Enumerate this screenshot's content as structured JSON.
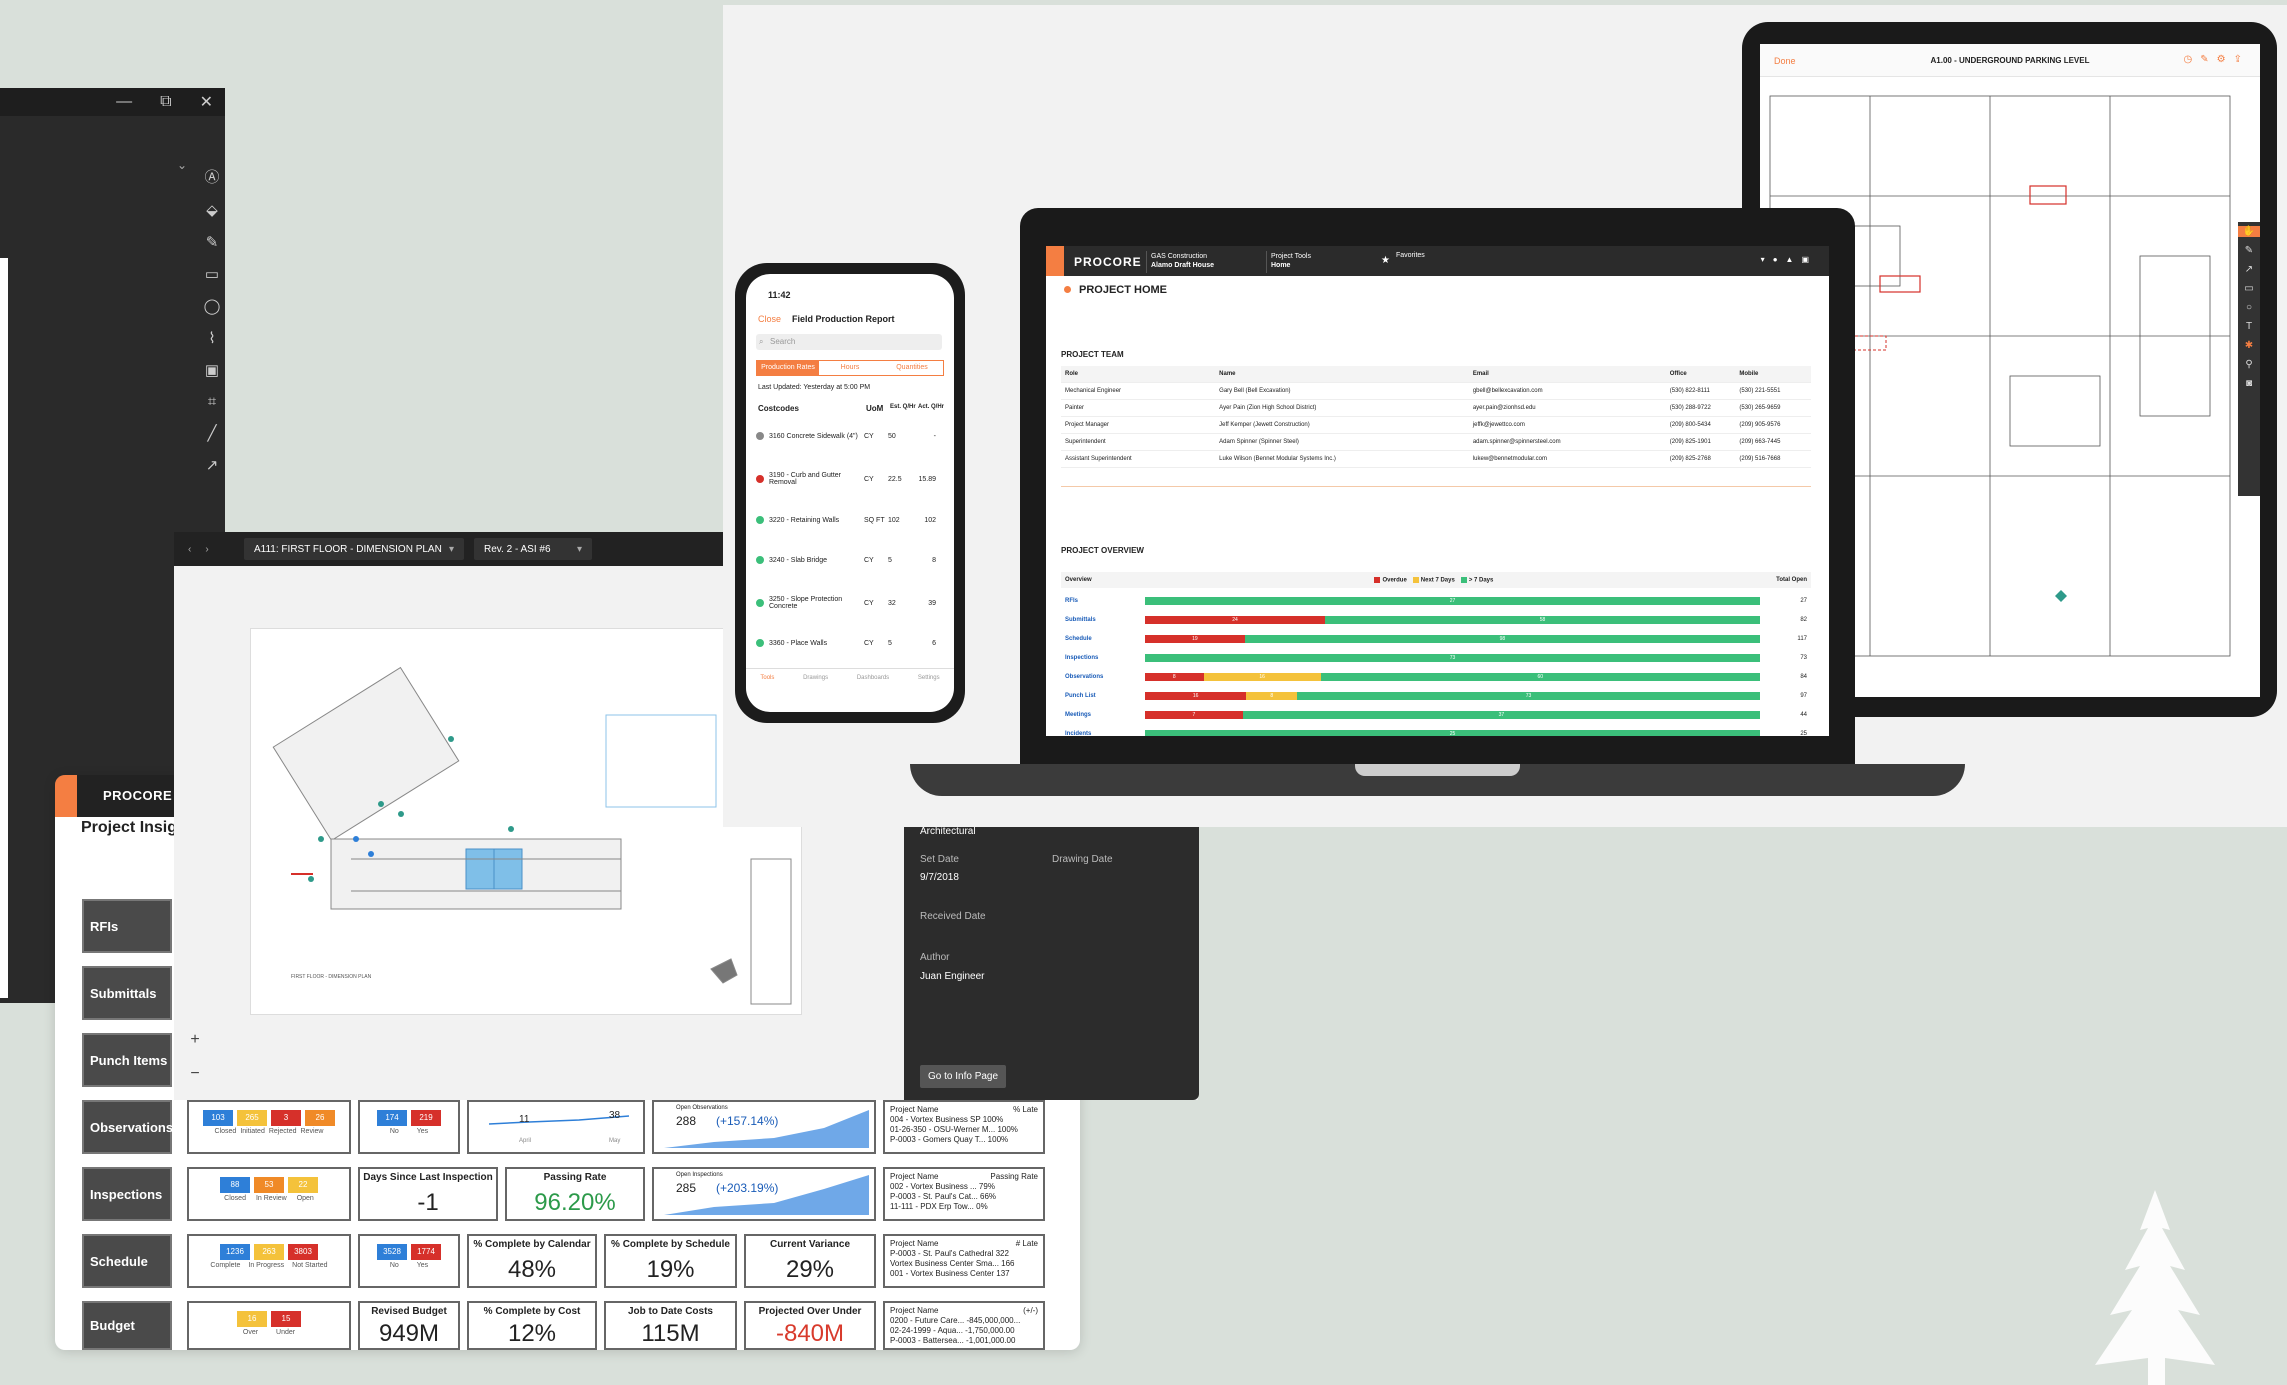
{
  "desktop_window": {
    "titlebar_controls": [
      "—",
      "⧉",
      "✕"
    ],
    "tool_icons": [
      "text-tool-icon",
      "fill-icon",
      "pen-icon",
      "text-box-icon",
      "lasso-icon",
      "callout-icon",
      "image-icon",
      "crop-icon",
      "line-icon",
      "arrow-icon",
      "arc-icon"
    ]
  },
  "insights": {
    "brand": "PROCORE",
    "title": "Project Insigl",
    "rows": [
      {
        "label": "RFIs"
      },
      {
        "label": "Submittals"
      },
      {
        "label": "Punch Items"
      },
      {
        "label": "Observations"
      },
      {
        "label": "Inspections"
      },
      {
        "label": "Schedule"
      },
      {
        "label": "Budget"
      }
    ],
    "observations": {
      "chips": [
        "103",
        "265",
        "3",
        "26"
      ],
      "chip_labels": [
        "Closed",
        "Initiated",
        "Rejected",
        "Review"
      ],
      "nos": [
        "174",
        "219"
      ],
      "no_yes": [
        "No",
        "Yes"
      ],
      "trend_low": "11",
      "trend_high": "38",
      "trend_months": [
        "April",
        "May"
      ],
      "open_label": "Open Observations",
      "open_value": "288",
      "open_delta": "(+157.14%)",
      "table_head": [
        "Project Name",
        "% Late"
      ],
      "table_rows": [
        "004 - Vortex Business SP   100%",
        "01-26-350 - OSU-Werner M...   100%",
        "P-0003 - Gomers Quay T...   100%"
      ]
    },
    "inspections": {
      "chips": [
        "88",
        "53",
        "22"
      ],
      "chip_labels": [
        "Closed",
        "In Review",
        "Open"
      ],
      "days_label": "Days Since Last Inspection",
      "days_value": "-1",
      "passing_label": "Passing Rate",
      "passing_value": "96.20%",
      "open_label": "Open Inspections",
      "open_value": "285",
      "open_delta": "(+203.19%)",
      "table_head": [
        "Project Name",
        "Passing Rate"
      ],
      "table_rows": [
        "002 - Vortex Business ...   79%",
        "P-0003 - St. Paul's Cat...   66%",
        "11-111 - PDX Erp Tow...   0%"
      ]
    },
    "schedule": {
      "chips": [
        "1236",
        "263",
        "3803"
      ],
      "chip_labels": [
        "Complete",
        "In Progress",
        "Not Started"
      ],
      "nos": [
        "3528",
        "1774"
      ],
      "no_yes": [
        "No",
        "Yes"
      ],
      "cal_label": "% Complete by Calendar",
      "cal_value": "48%",
      "sched_label": "% Complete by Schedule",
      "sched_value": "19%",
      "var_label": "Current Variance",
      "var_value": "29%",
      "table_head": [
        "Project Name",
        "# Late"
      ],
      "table_rows": [
        "P-0003 - St. Paul's Cathedral   322",
        "Vortex Business Center Sma...   166",
        "001 - Vortex Business Center   137"
      ]
    },
    "budget": {
      "chips": [
        "16",
        "15"
      ],
      "chip_labels": [
        "Over",
        "Under"
      ],
      "revised_label": "Revised Budget",
      "revised_value": "949M",
      "cost_label": "% Complete by Cost",
      "cost_value": "12%",
      "jtd_label": "Job to Date Costs",
      "jtd_value": "115M",
      "proj_label": "Projected Over Under",
      "proj_value": "-840M",
      "table_head": [
        "Project Name",
        "(+/-)"
      ],
      "table_rows": [
        "0200 - Future Care...   -845,000,000...",
        "02-24-1999 - Aqua...   -1,750,000.00",
        "P-0003 - Battersea...   -1,001,000.00"
      ]
    }
  },
  "drawing": {
    "nav_prev": "‹",
    "nav_next": "›",
    "sheet_select": "A111: FIRST FLOOR - DIMENSION PLAN",
    "revision_select": "Rev. 2 - ASI #6",
    "title_block": "FIRST FLOOR - DIMENSION PLAN",
    "zoom_in": "+",
    "zoom_out": "−",
    "info": {
      "discipline": "Architectural",
      "set_date_label": "Set Date",
      "set_date": "9/7/2018",
      "drawing_date_label": "Drawing Date",
      "received_label": "Received Date",
      "author_label": "Author",
      "author": "Juan Engineer",
      "button": "Go to Info Page"
    }
  },
  "phone": {
    "time": "11:42",
    "close": "Close",
    "title": "Field Production Report",
    "search_placeholder": "Search",
    "tabs": [
      "Production Rates",
      "Hours",
      "Quantities"
    ],
    "updated": "Last Updated: Yesterday at 5:00 PM",
    "columns": [
      "Costcodes",
      "UoM",
      "Est. Q/Hr",
      "Act. Q/Hr"
    ],
    "rows": [
      {
        "code": "3160 Concrete Sidewalk (4\")",
        "uom": "CY",
        "est": "50",
        "act": "-",
        "status": "#888888"
      },
      {
        "code": "3190 - Curb and Gutter Removal",
        "uom": "CY",
        "est": "22.5",
        "act": "15.89",
        "status": "#d6302a"
      },
      {
        "code": "3220 - Retaining Walls",
        "uom": "SQ FT",
        "est": "102",
        "act": "102",
        "status": "#3bbf7a"
      },
      {
        "code": "3240 - Slab Bridge",
        "uom": "CY",
        "est": "5",
        "act": "8",
        "status": "#3bbf7a"
      },
      {
        "code": "3250 - Slope Protection Concrete",
        "uom": "CY",
        "est": "32",
        "act": "39",
        "status": "#3bbf7a"
      },
      {
        "code": "3360 - Place Walls",
        "uom": "CY",
        "est": "5",
        "act": "6",
        "status": "#3bbf7a"
      }
    ],
    "tabbar": [
      "Tools",
      "Drawings",
      "Dashboards",
      "Settings"
    ]
  },
  "laptop": {
    "brand": "PROCORE",
    "company_label": "GAS Construction",
    "project": "Alamo Draft House",
    "tools_label": "Project Tools",
    "tools_value": "Home",
    "favorites": "Favorites",
    "page_title": "PROJECT HOME",
    "team_title": "PROJECT TEAM",
    "team_headers": [
      "Role",
      "Name",
      "Email",
      "Office",
      "Mobile"
    ],
    "team": [
      [
        "Mechanical Engineer",
        "Gary Bell (Bell Excavation)",
        "gbell@bellexcavation.com",
        "(530) 822-8111",
        "(530) 221-5551"
      ],
      [
        "Painter",
        "Ayer Pain (Zion High School District)",
        "ayer.pain@zionhsd.edu",
        "(530) 288-9722",
        "(530) 265-9659"
      ],
      [
        "Project Manager",
        "Jeff Kemper (Jewett Construction)",
        "jeffk@jewettco.com",
        "(209) 800-5434",
        "(209) 905-9576"
      ],
      [
        "Superintendent",
        "Adam Spinner (Spinner Steel)",
        "adam.spinner@spinnersteel.com",
        "(209) 825-1901",
        "(209) 663-7445"
      ],
      [
        "Assistant Superintendent",
        "Luke Wilson (Bennet Modular Systems Inc.)",
        "lukew@bennetmodular.com",
        "(209) 825-2768",
        "(209) 516-7668"
      ]
    ],
    "overview_title": "PROJECT OVERVIEW",
    "overview_header": "Overview",
    "overview_total_header": "Total Open",
    "legend": [
      "Overdue",
      "Next 7 Days",
      "> 7 Days"
    ],
    "overview": [
      {
        "name": "RFIs",
        "overdue": 0,
        "next7": 0,
        "later": 27,
        "total": "27"
      },
      {
        "name": "Submittals",
        "overdue": 24,
        "next7": 0,
        "later": 58,
        "total": "82"
      },
      {
        "name": "Schedule",
        "overdue": 19,
        "next7": 0,
        "later": 98,
        "total": "117"
      },
      {
        "name": "Inspections",
        "overdue": 0,
        "next7": 0,
        "later": 73,
        "total": "73"
      },
      {
        "name": "Observations",
        "overdue": 8,
        "next7": 16,
        "later": 60,
        "total": "84"
      },
      {
        "name": "Punch List",
        "overdue": 16,
        "next7": 8,
        "later": 73,
        "total": "97"
      },
      {
        "name": "Meetings",
        "overdue": 7,
        "next7": 0,
        "later": 37,
        "total": "44"
      },
      {
        "name": "Incidents",
        "overdue": 0,
        "next7": 0,
        "later": 25,
        "total": "25"
      }
    ]
  },
  "tablet": {
    "done": "Done",
    "title": "A1.00 - UNDERGROUND PARKING LEVEL"
  },
  "colors": {
    "brand_orange": "#f47e42",
    "overdue": "#d6302a",
    "next7": "#f4c23b",
    "later": "#3bbf7a"
  }
}
